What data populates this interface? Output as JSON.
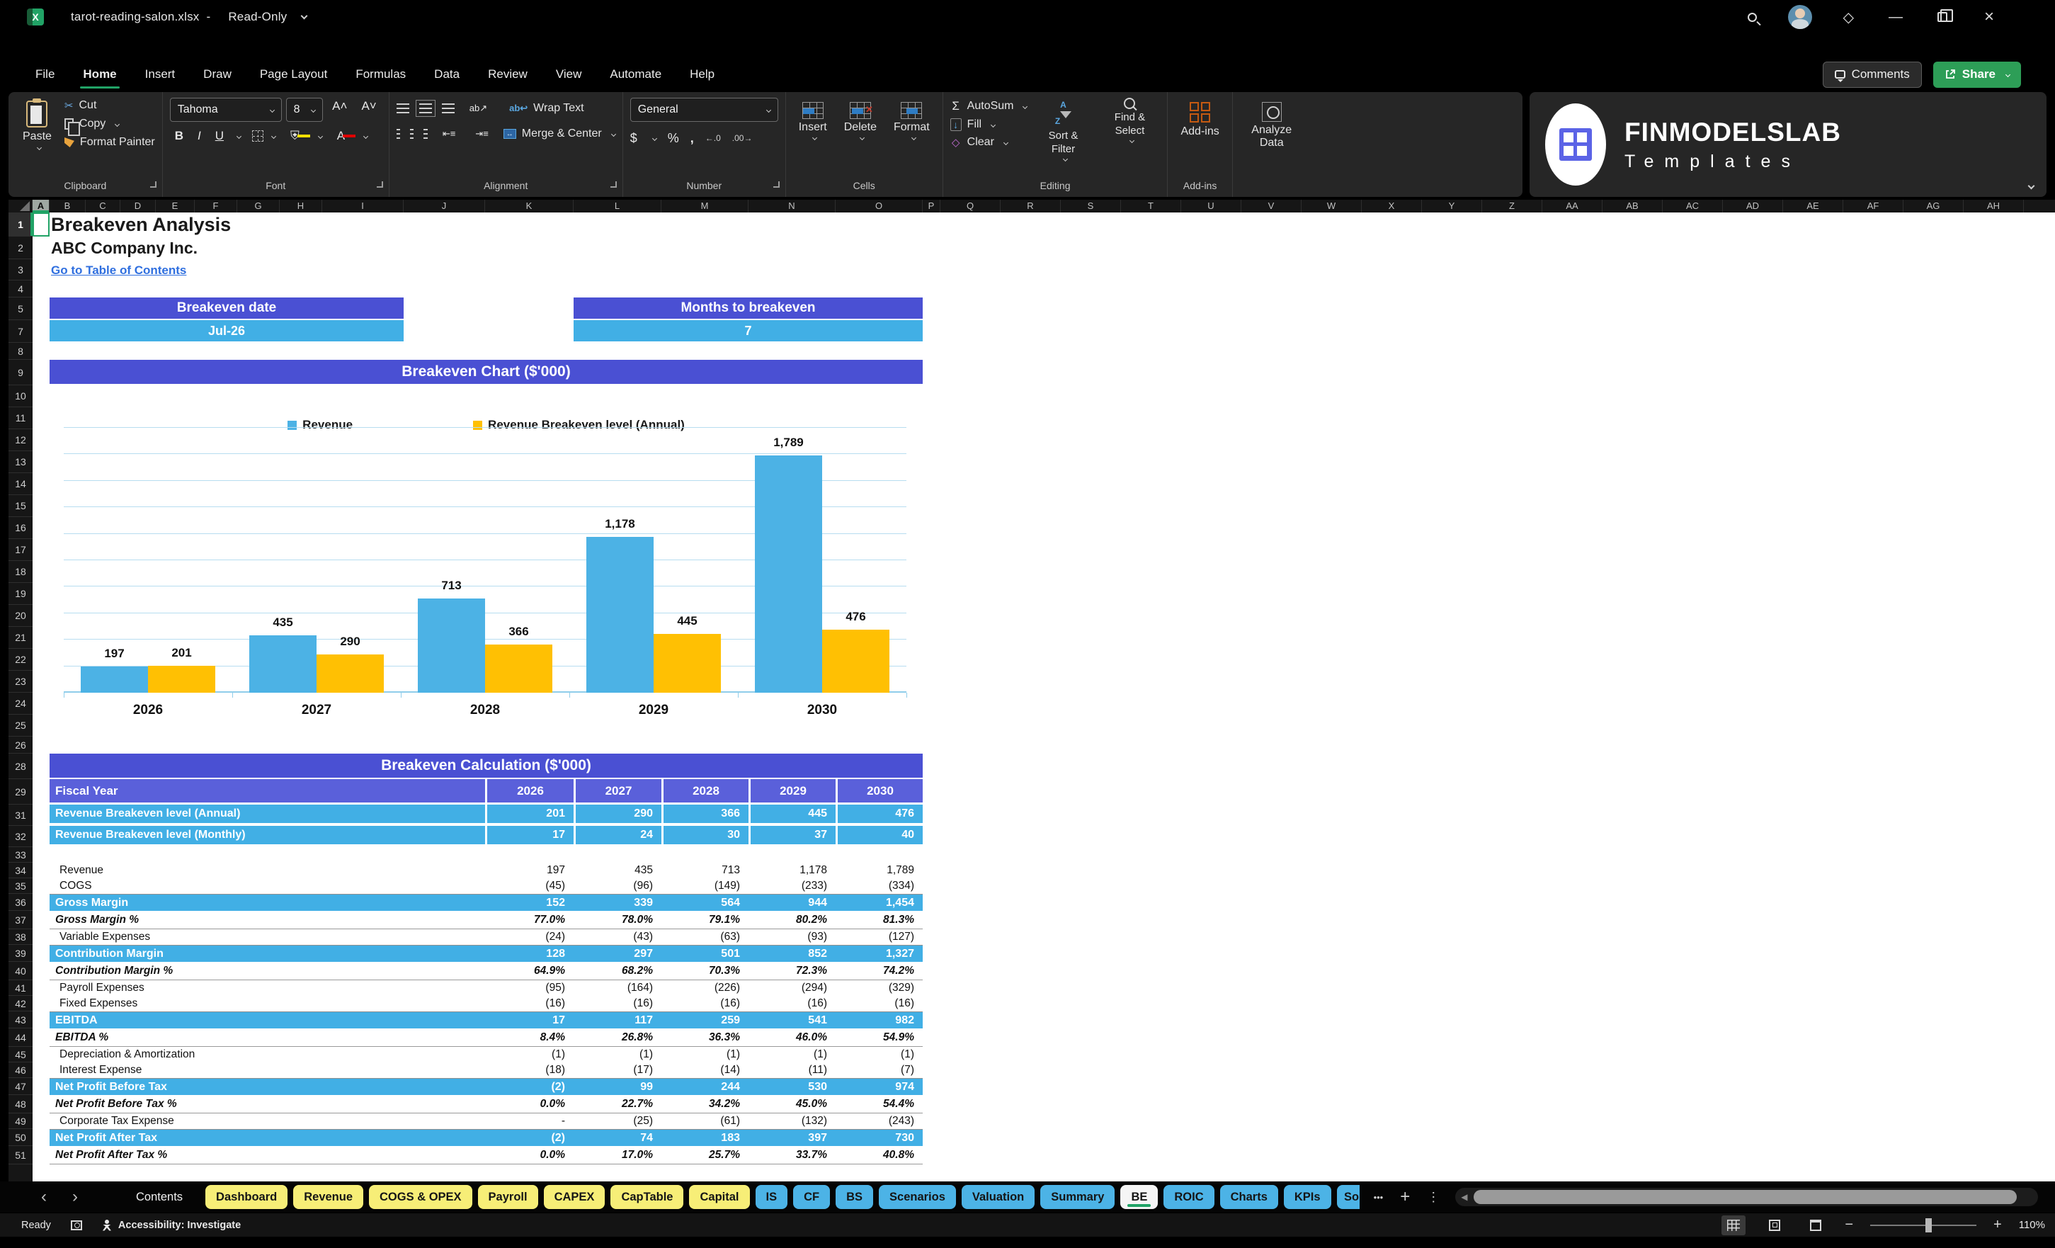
{
  "colors": {
    "accent_green": "#21a366",
    "share_green": "#2d9e57",
    "indigo_header": "#4a50d3",
    "fiscal_indigo": "#5a60da",
    "band_blue": "#41afe5",
    "bar_blue": "#4cb2e5",
    "bar_yellow": "#ffc003",
    "link_blue": "#2f6fdf",
    "tab_yellow": "#f7ee77",
    "tab_blue": "#4cb3e6"
  },
  "title_bar": {
    "file_name": "tarot-reading-salon.xlsx",
    "dash": "-",
    "mode": "Read-Only"
  },
  "menu": {
    "tabs": [
      {
        "label": "File"
      },
      {
        "label": "Home",
        "active": true
      },
      {
        "label": "Insert"
      },
      {
        "label": "Draw"
      },
      {
        "label": "Page Layout"
      },
      {
        "label": "Formulas"
      },
      {
        "label": "Data"
      },
      {
        "label": "Review"
      },
      {
        "label": "View"
      },
      {
        "label": "Automate"
      },
      {
        "label": "Help"
      }
    ],
    "comments": "Comments",
    "share": "Share"
  },
  "ribbon": {
    "clipboard": {
      "label": "Clipboard",
      "paste": "Paste",
      "cut": "Cut",
      "copy": "Copy",
      "format_painter": "Format Painter"
    },
    "font": {
      "label": "Font",
      "family": "Tahoma",
      "size": "8"
    },
    "alignment": {
      "label": "Alignment",
      "wrap": "Wrap Text",
      "merge": "Merge & Center"
    },
    "number": {
      "label": "Number",
      "format": "General",
      "dec_left": "←.0",
      "dec_right": ".00→"
    },
    "cells": {
      "label": "Cells",
      "insert": "Insert",
      "del": "Delete",
      "format": "Format"
    },
    "editing": {
      "label": "Editing",
      "autosum": "AutoSum",
      "fill": "Fill",
      "clear": "Clear",
      "sort": "Sort & Filter",
      "find": "Find & Select"
    },
    "addins": {
      "label": "Add-ins",
      "button": "Add-ins",
      "analyze": "Analyze Data"
    }
  },
  "brand": {
    "name": "FINMODELSLAB",
    "sub": "Templates"
  },
  "sheet": {
    "title": "Breakeven Analysis",
    "company": "ABC Company Inc.",
    "link": "Go to Table of Contents",
    "kpi": {
      "date_label": "Breakeven date",
      "date_value": "Jul-26",
      "months_label": "Months to breakeven",
      "months_value": "7"
    },
    "chart_title": "Breakeven Chart ($'000)",
    "calc_title": "Breakeven Calculation ($'000)"
  },
  "grid": {
    "columns": [
      {
        "name": "A",
        "w": 24,
        "sel": true
      },
      {
        "name": "B",
        "w": 51
      },
      {
        "name": "C",
        "w": 49
      },
      {
        "name": "D",
        "w": 50
      },
      {
        "name": "E",
        "w": 55
      },
      {
        "name": "F",
        "w": 60
      },
      {
        "name": "G",
        "w": 60
      },
      {
        "name": "H",
        "w": 60
      },
      {
        "name": "I",
        "w": 115
      },
      {
        "name": "J",
        "w": 115
      },
      {
        "name": "K",
        "w": 125
      },
      {
        "name": "L",
        "w": 124
      },
      {
        "name": "M",
        "w": 123
      },
      {
        "name": "N",
        "w": 123
      },
      {
        "name": "O",
        "w": 123
      },
      {
        "name": "P",
        "w": 25
      },
      {
        "name": "Q",
        "w": 85
      },
      {
        "name": "R",
        "w": 85
      },
      {
        "name": "S",
        "w": 85
      },
      {
        "name": "T",
        "w": 85
      },
      {
        "name": "U",
        "w": 85
      },
      {
        "name": "V",
        "w": 85
      },
      {
        "name": "W",
        "w": 85
      },
      {
        "name": "X",
        "w": 85
      },
      {
        "name": "Y",
        "w": 85
      },
      {
        "name": "Z",
        "w": 85
      },
      {
        "name": "AA",
        "w": 85
      },
      {
        "name": "AB",
        "w": 85
      },
      {
        "name": "AC",
        "w": 85
      },
      {
        "name": "AD",
        "w": 85
      },
      {
        "name": "AE",
        "w": 85
      },
      {
        "name": "AF",
        "w": 85
      },
      {
        "name": "AG",
        "w": 85
      },
      {
        "name": "AH",
        "w": 85
      }
    ],
    "rows": [
      {
        "n": 1,
        "h": 34,
        "sel": true
      },
      {
        "n": 2,
        "h": 32
      },
      {
        "n": 3,
        "h": 30
      },
      {
        "n": 4,
        "h": 24
      },
      {
        "n": 5,
        "h": 32
      },
      {
        "n": 7,
        "h": 32
      },
      {
        "n": 8,
        "h": 24
      },
      {
        "n": 9,
        "h": 36
      },
      {
        "n": 10,
        "h": 31
      },
      {
        "n": 11,
        "h": 31
      },
      {
        "n": 12,
        "h": 31
      },
      {
        "n": 13,
        "h": 31
      },
      {
        "n": 14,
        "h": 31
      },
      {
        "n": 15,
        "h": 31
      },
      {
        "n": 16,
        "h": 31
      },
      {
        "n": 17,
        "h": 31
      },
      {
        "n": 18,
        "h": 31
      },
      {
        "n": 19,
        "h": 31
      },
      {
        "n": 20,
        "h": 31
      },
      {
        "n": 21,
        "h": 31
      },
      {
        "n": 22,
        "h": 31
      },
      {
        "n": 23,
        "h": 31
      },
      {
        "n": 24,
        "h": 31
      },
      {
        "n": 25,
        "h": 31
      },
      {
        "n": 26,
        "h": 24
      },
      {
        "n": 28,
        "h": 36
      },
      {
        "n": 29,
        "h": 36
      },
      {
        "n": 31,
        "h": 30
      },
      {
        "n": 32,
        "h": 30
      },
      {
        "n": 33,
        "h": 22
      },
      {
        "n": 34,
        "h": 22
      },
      {
        "n": 35,
        "h": 22
      },
      {
        "n": 36,
        "h": 24
      },
      {
        "n": 37,
        "h": 26
      },
      {
        "n": 38,
        "h": 22
      },
      {
        "n": 39,
        "h": 24
      },
      {
        "n": 40,
        "h": 26
      },
      {
        "n": 41,
        "h": 22
      },
      {
        "n": 42,
        "h": 22
      },
      {
        "n": 43,
        "h": 24
      },
      {
        "n": 44,
        "h": 26
      },
      {
        "n": 45,
        "h": 22
      },
      {
        "n": 46,
        "h": 22
      },
      {
        "n": 47,
        "h": 24
      },
      {
        "n": 48,
        "h": 26
      },
      {
        "n": 49,
        "h": 22
      },
      {
        "n": 50,
        "h": 24
      },
      {
        "n": 51,
        "h": 26
      }
    ]
  },
  "chart_data": {
    "type": "bar",
    "title": "Breakeven Chart ($'000)",
    "categories": [
      "2026",
      "2027",
      "2028",
      "2029",
      "2030"
    ],
    "series": [
      {
        "name": "Revenue",
        "color": "#4cb2e5",
        "values": [
          197,
          435,
          713,
          1178,
          1789
        ]
      },
      {
        "name": "Revenue Breakeven level (Annual)",
        "color": "#ffc003",
        "values": [
          201,
          290,
          366,
          445,
          476
        ]
      }
    ],
    "xlabel": "",
    "ylabel": "",
    "ylim": [
      0,
      2000
    ],
    "gridline_step": 200,
    "grid": true,
    "legend_position": "top",
    "data_labels": true
  },
  "calc_table": {
    "header": {
      "label": "Fiscal Year",
      "years": [
        "2026",
        "2027",
        "2028",
        "2029",
        "2030"
      ]
    },
    "rows": [
      {
        "row": 31,
        "label": "Revenue Breakeven level (Annual)",
        "values": [
          "201",
          "290",
          "366",
          "445",
          "476"
        ],
        "style": "band"
      },
      {
        "row": 32,
        "label": "Revenue Breakeven level (Monthly)",
        "values": [
          "17",
          "24",
          "30",
          "37",
          "40"
        ],
        "style": "band"
      },
      {
        "row": 33,
        "label": "",
        "values": [
          "",
          "",
          "",
          "",
          ""
        ],
        "style": "blank"
      },
      {
        "row": 34,
        "label": "Revenue",
        "values": [
          "197",
          "435",
          "713",
          "1,178",
          "1,789"
        ],
        "style": "normal"
      },
      {
        "row": 35,
        "label": "COGS",
        "values": [
          "(45)",
          "(96)",
          "(149)",
          "(233)",
          "(334)"
        ],
        "style": "normal"
      },
      {
        "row": 36,
        "label": "Gross Margin",
        "values": [
          "152",
          "339",
          "564",
          "944",
          "1,454"
        ],
        "style": "subtotal"
      },
      {
        "row": 37,
        "label": "Gross Margin %",
        "values": [
          "77.0%",
          "78.0%",
          "79.1%",
          "80.2%",
          "81.3%"
        ],
        "style": "percent"
      },
      {
        "row": 38,
        "label": "Variable Expenses",
        "values": [
          "(24)",
          "(43)",
          "(63)",
          "(93)",
          "(127)"
        ],
        "style": "normal"
      },
      {
        "row": 39,
        "label": "Contribution Margin",
        "values": [
          "128",
          "297",
          "501",
          "852",
          "1,327"
        ],
        "style": "subtotal"
      },
      {
        "row": 40,
        "label": "Contribution Margin %",
        "values": [
          "64.9%",
          "68.2%",
          "70.3%",
          "72.3%",
          "74.2%"
        ],
        "style": "percent"
      },
      {
        "row": 41,
        "label": "Payroll Expenses",
        "values": [
          "(95)",
          "(164)",
          "(226)",
          "(294)",
          "(329)"
        ],
        "style": "normal"
      },
      {
        "row": 42,
        "label": "Fixed Expenses",
        "values": [
          "(16)",
          "(16)",
          "(16)",
          "(16)",
          "(16)"
        ],
        "style": "normal"
      },
      {
        "row": 43,
        "label": "EBITDA",
        "values": [
          "17",
          "117",
          "259",
          "541",
          "982"
        ],
        "style": "subtotal"
      },
      {
        "row": 44,
        "label": "EBITDA %",
        "values": [
          "8.4%",
          "26.8%",
          "36.3%",
          "46.0%",
          "54.9%"
        ],
        "style": "percent"
      },
      {
        "row": 45,
        "label": "Depreciation & Amortization",
        "values": [
          "(1)",
          "(1)",
          "(1)",
          "(1)",
          "(1)"
        ],
        "style": "normal"
      },
      {
        "row": 46,
        "label": "Interest Expense",
        "values": [
          "(18)",
          "(17)",
          "(14)",
          "(11)",
          "(7)"
        ],
        "style": "normal"
      },
      {
        "row": 47,
        "label": "Net Profit Before Tax",
        "values": [
          "(2)",
          "99",
          "244",
          "530",
          "974"
        ],
        "style": "subtotal"
      },
      {
        "row": 48,
        "label": "Net Profit Before Tax %",
        "values": [
          "0.0%",
          "22.7%",
          "34.2%",
          "45.0%",
          "54.4%"
        ],
        "style": "percent"
      },
      {
        "row": 49,
        "label": "Corporate Tax Expense",
        "values": [
          "-",
          "(25)",
          "(61)",
          "(132)",
          "(243)"
        ],
        "style": "normal"
      },
      {
        "row": 50,
        "label": "Net Profit After Tax",
        "values": [
          "(2)",
          "74",
          "183",
          "397",
          "730"
        ],
        "style": "subtotal"
      },
      {
        "row": 51,
        "label": "Net Profit After Tax %",
        "values": [
          "0.0%",
          "17.0%",
          "25.7%",
          "33.7%",
          "40.8%"
        ],
        "style": "percent"
      }
    ]
  },
  "sheet_tabs": {
    "nav_left": "‹",
    "nav_right": "›",
    "tabs": [
      {
        "label": "Contents",
        "type": "plain"
      },
      {
        "label": "Dashboard",
        "type": "yellow"
      },
      {
        "label": "Revenue",
        "type": "yellow"
      },
      {
        "label": "COGS & OPEX",
        "type": "yellow"
      },
      {
        "label": "Payroll",
        "type": "yellow"
      },
      {
        "label": "CAPEX",
        "type": "yellow"
      },
      {
        "label": "CapTable",
        "type": "yellow"
      },
      {
        "label": "Capital",
        "type": "yellow"
      },
      {
        "label": "IS",
        "type": "blue"
      },
      {
        "label": "CF",
        "type": "blue"
      },
      {
        "label": "BS",
        "type": "blue"
      },
      {
        "label": "Scenarios",
        "type": "blue"
      },
      {
        "label": "Valuation",
        "type": "blue"
      },
      {
        "label": "Summary",
        "type": "blue"
      },
      {
        "label": "BE",
        "type": "active"
      },
      {
        "label": "ROIC",
        "type": "blue"
      },
      {
        "label": "Charts",
        "type": "blue"
      },
      {
        "label": "KPIs",
        "type": "blue"
      },
      {
        "label": "So",
        "type": "blue",
        "clipped": true
      }
    ],
    "overflow": "•••",
    "add": "+",
    "menu": "⋮"
  },
  "status_bar": {
    "ready": "Ready",
    "accessibility": "Accessibility: Investigate",
    "zoom_level": "110%"
  }
}
